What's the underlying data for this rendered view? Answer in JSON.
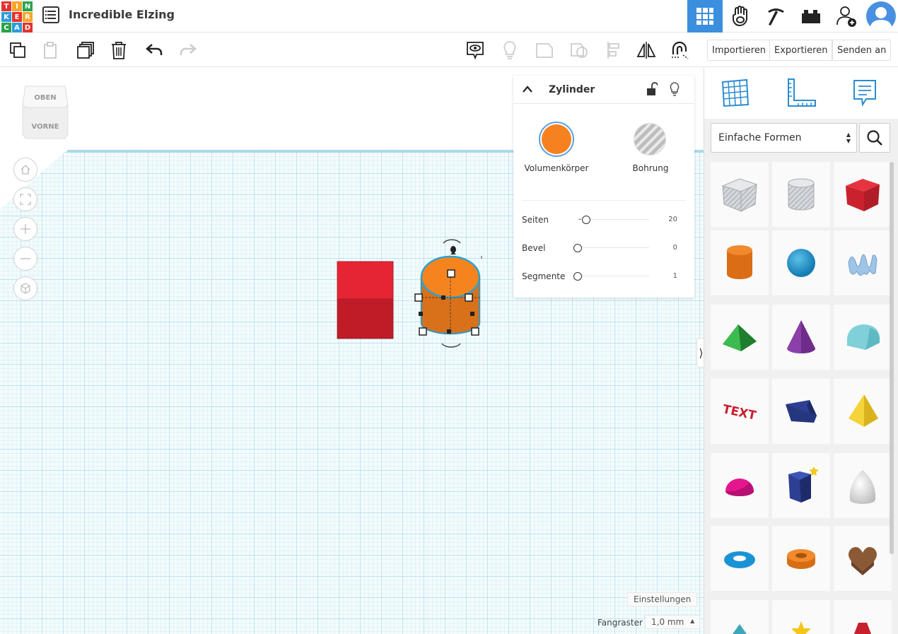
{
  "header": {
    "logo_letters": [
      "T",
      "I",
      "N",
      "K",
      "E",
      "R",
      "C",
      "A",
      "D"
    ],
    "document_title": "Incredible Elzing"
  },
  "toolbar": {
    "import_label": "Importieren",
    "export_label": "Exportieren",
    "send_label": "Senden an"
  },
  "viewcube": {
    "top_label": "OBEN",
    "front_label": "VORNE"
  },
  "shape_panel": {
    "title": "Zylinder",
    "solid_label": "Volumenkörper",
    "hole_label": "Bohrung",
    "solid_color": "#F5821F",
    "sliders": [
      {
        "label": "Seiten",
        "value": "20",
        "fraction": 0.12
      },
      {
        "label": "Bevel",
        "value": "0",
        "fraction": 0.0
      },
      {
        "label": "Segmente",
        "value": "1",
        "fraction": 0.0
      }
    ]
  },
  "bottom": {
    "settings_label": "Einstellungen",
    "snap_label": "Fangraster",
    "snap_value": "1,0 mm"
  },
  "sidebar": {
    "category": "Einfache Formen",
    "shapes": [
      "box-hole-icon",
      "cylinder-hole-icon",
      "box-icon",
      "cylinder-icon",
      "sphere-icon",
      "scribble-icon",
      "roof-icon",
      "cone-icon",
      "round-roof-icon",
      "text-icon",
      "wedge-icon",
      "pyramid-icon",
      "half-sphere-icon",
      "polygon-icon",
      "paraboloid-icon",
      "torus-icon",
      "tube-icon",
      "heart-icon"
    ]
  },
  "colors": {
    "accent": "#3B8FDE",
    "cube_red": "#E0202B",
    "cylinder_orange": "#F5821F",
    "grid_blue": "#BFE3EE"
  }
}
